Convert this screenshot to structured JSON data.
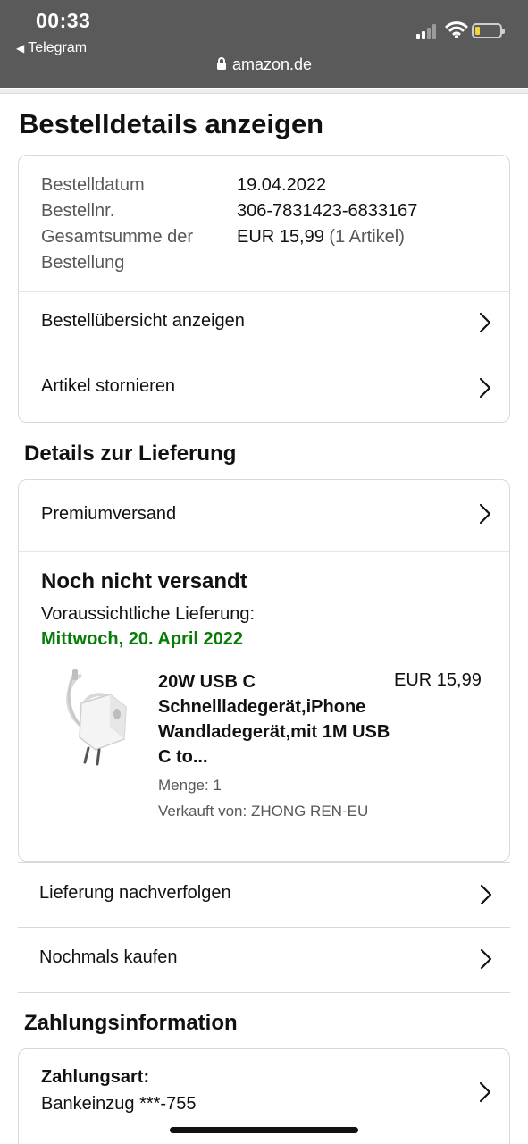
{
  "status_bar": {
    "time": "00:33",
    "back_app": "Telegram"
  },
  "browser": {
    "url": "amazon.de"
  },
  "page_title": "Bestelldetails anzeigen",
  "order_summary": {
    "date_label": "Bestelldatum",
    "date_value": "19.04.2022",
    "number_label": "Bestellnr.",
    "number_value": "306-7831423-6833167",
    "total_label": "Gesamtsumme der Bestellung",
    "total_value": "EUR 15,99",
    "total_items": "(1 Artikel)"
  },
  "links": {
    "overview": "Bestellübersicht anzeigen",
    "cancel": "Artikel stornieren"
  },
  "delivery": {
    "section_title": "Details zur Lieferung",
    "shipping_method": "Premiumversand",
    "status": "Noch nicht versandt",
    "eta_label": "Voraussichtliche Lieferung:",
    "eta_date": "Mittwoch, 20. April 2022",
    "eta_color": "#067d06",
    "product": {
      "name": "20W USB C Schnellladegerät,iPhone Wandladegerät,mit 1M USB C to...",
      "price": "EUR 15,99",
      "quantity": "Menge: 1",
      "seller": "Verkauft von: ZHONG REN-EU"
    }
  },
  "actions": {
    "track": "Lieferung nachverfolgen",
    "buy_again": "Nochmals kaufen"
  },
  "payment": {
    "section_title": "Zahlungsinformation",
    "method_label": "Zahlungsart:",
    "method_value": "Bankeinzug ***-755"
  }
}
